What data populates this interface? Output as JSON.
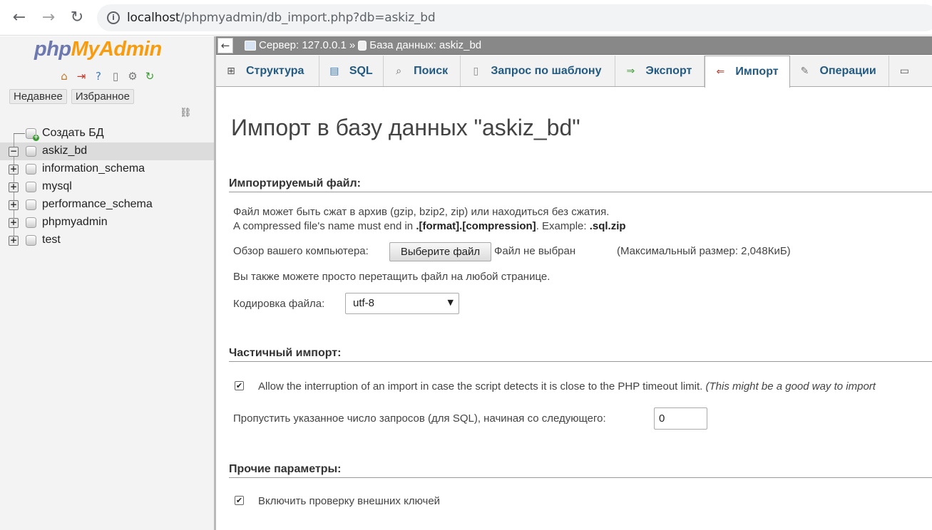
{
  "browser": {
    "back_icon": "←",
    "forward_icon": "→",
    "reload_icon": "↻",
    "url_host": "localhost",
    "url_path": "/phpmyadmin/db_import.php?db=askiz_bd"
  },
  "sidebar": {
    "logo_php": "php",
    "logo_myadmin": "MyAdmin",
    "recent_label": "Недавнее",
    "favorites_label": "Избранное",
    "tree": [
      {
        "label": "Создать БД",
        "type": "new"
      },
      {
        "label": "askiz_bd",
        "type": "db",
        "expanded": true,
        "selected": true
      },
      {
        "label": "information_schema",
        "type": "db"
      },
      {
        "label": "mysql",
        "type": "db"
      },
      {
        "label": "performance_schema",
        "type": "db"
      },
      {
        "label": "phpmyadmin",
        "type": "db"
      },
      {
        "label": "test",
        "type": "db"
      }
    ]
  },
  "breadcrumb": {
    "server": "Сервер: 127.0.0.1",
    "separator": "»",
    "database": "База данных: askiz_bd"
  },
  "tabs": [
    {
      "label": "Структура",
      "icon": "structure-icon",
      "active": false
    },
    {
      "label": "SQL",
      "icon": "sql-icon",
      "active": false
    },
    {
      "label": "Поиск",
      "icon": "search-icon",
      "active": false
    },
    {
      "label": "Запрос по шаблону",
      "icon": "query-icon",
      "active": false
    },
    {
      "label": "Экспорт",
      "icon": "export-icon",
      "active": false
    },
    {
      "label": "Импорт",
      "icon": "import-icon",
      "active": true
    },
    {
      "label": "Операции",
      "icon": "operations-icon",
      "active": false
    }
  ],
  "main": {
    "title": "Импорт в базу данных \"askiz_bd\"",
    "file_section": {
      "title": "Импортируемый файл:",
      "compress_note": "Файл может быть сжат в архив (gzip, bzip2, zip) или находиться без сжатия.",
      "compressed_prefix": "A compressed file's name must end in ",
      "compressed_format": ".[format].[compression]",
      "compressed_mid": ". Example: ",
      "compressed_example": ".sql.zip",
      "browse_label": "Обзор вашего компьютера:",
      "choose_button": "Выберите файл",
      "no_file": "Файл не выбран",
      "max_size": "(Максимальный размер: 2,048КиБ)",
      "drag_note": "Вы также можете просто перетащить файл на любой странице.",
      "encoding_label": "Кодировка файла:",
      "encoding_value": "utf-8"
    },
    "partial_section": {
      "title": "Частичный импорт:",
      "interrupt_label": "Allow the interruption of an import in case the script detects it is close to the PHP timeout limit.",
      "interrupt_hint": "(This might be a good way to import",
      "interrupt_checked": true,
      "skip_label": "Пропустить указанное число запросов (для SQL), начиная со следующего:",
      "skip_value": "0"
    },
    "other_section": {
      "title": "Прочие параметры:",
      "fk_label": "Включить проверку внешних ключей",
      "fk_checked": true
    }
  }
}
